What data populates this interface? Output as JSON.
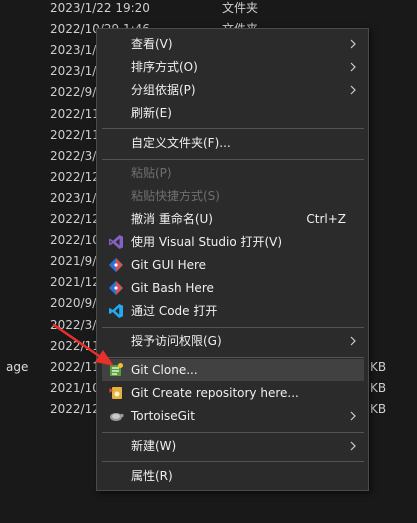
{
  "file_list": {
    "rows": [
      {
        "name": "",
        "date": "2023/1/22 19:20",
        "type": "文件夹",
        "size": ""
      },
      {
        "name": "",
        "date": "2022/10/29 1:46",
        "type": "文件夹",
        "size": ""
      },
      {
        "name": "",
        "date": "2023/1/",
        "type": "",
        "size": ""
      },
      {
        "name": "",
        "date": "2023/1/",
        "type": "",
        "size": ""
      },
      {
        "name": "",
        "date": "2022/9/",
        "type": "",
        "size": ""
      },
      {
        "name": "",
        "date": "2022/11",
        "type": "",
        "size": ""
      },
      {
        "name": "",
        "date": "2022/11",
        "type": "",
        "size": ""
      },
      {
        "name": "",
        "date": "2022/3/",
        "type": "",
        "size": ""
      },
      {
        "name": "",
        "date": "2022/12",
        "type": "",
        "size": ""
      },
      {
        "name": "",
        "date": "2023/1/",
        "type": "",
        "size": ""
      },
      {
        "name": "",
        "date": "2022/12",
        "type": "",
        "size": ""
      },
      {
        "name": "",
        "date": "2022/10",
        "type": "",
        "size": ""
      },
      {
        "name": "",
        "date": "2021/9/",
        "type": "",
        "size": ""
      },
      {
        "name": "",
        "date": "2021/12",
        "type": "",
        "size": ""
      },
      {
        "name": "",
        "date": "2020/9/",
        "type": "",
        "size": ""
      },
      {
        "name": "",
        "date": "2022/3/",
        "type": "",
        "size": ""
      },
      {
        "name": "",
        "date": "2022/11",
        "type": "",
        "size": ""
      },
      {
        "name": "age",
        "date": "2022/11",
        "type": "",
        "size": "KB"
      },
      {
        "name": "",
        "date": "2021/10",
        "type": "",
        "size": "KB"
      },
      {
        "name": "",
        "date": "2022/12",
        "type": "",
        "size": "KB"
      }
    ]
  },
  "context_menu": {
    "view": "查看(V)",
    "sort_by": "排序方式(O)",
    "group_by": "分组依据(P)",
    "refresh": "刷新(E)",
    "customize_folder": "自定义文件夹(F)...",
    "paste": "粘贴(P)",
    "paste_shortcut": "粘贴快捷方式(S)",
    "undo_rename": "撤消 重命名(U)",
    "undo_shortcut": "Ctrl+Z",
    "open_with_vs": "使用 Visual Studio 打开(V)",
    "git_gui_here": "Git GUI Here",
    "git_bash_here": "Git Bash Here",
    "open_with_code": "通过 Code 打开",
    "give_access_to": "授予访问权限(G)",
    "git_clone": "Git Clone...",
    "git_create_repo": "Git Create repository here...",
    "tortoisegit": "TortoiseGit",
    "new": "新建(W)",
    "properties": "属性(R)"
  },
  "icons": {
    "visual_studio": "visual-studio-icon",
    "git_gui": "git-diamond-icon",
    "git_bash": "git-diamond-icon",
    "vscode": "vscode-icon",
    "git_clone": "tortoisegit-clone-icon",
    "git_create": "tortoisegit-create-icon",
    "tortoisegit": "tortoisegit-icon",
    "annotation": "red-arrow-pointer"
  },
  "colors": {
    "menu_bg": "#2b2b2b",
    "menu_hover": "#414141",
    "text": "#f0f0f0",
    "disabled_text": "#6f6f6f",
    "vs_purple": "#8661c5",
    "git_orange": "#f05133",
    "vscode_blue": "#23a9f2",
    "annotation_red": "#e8302a"
  }
}
